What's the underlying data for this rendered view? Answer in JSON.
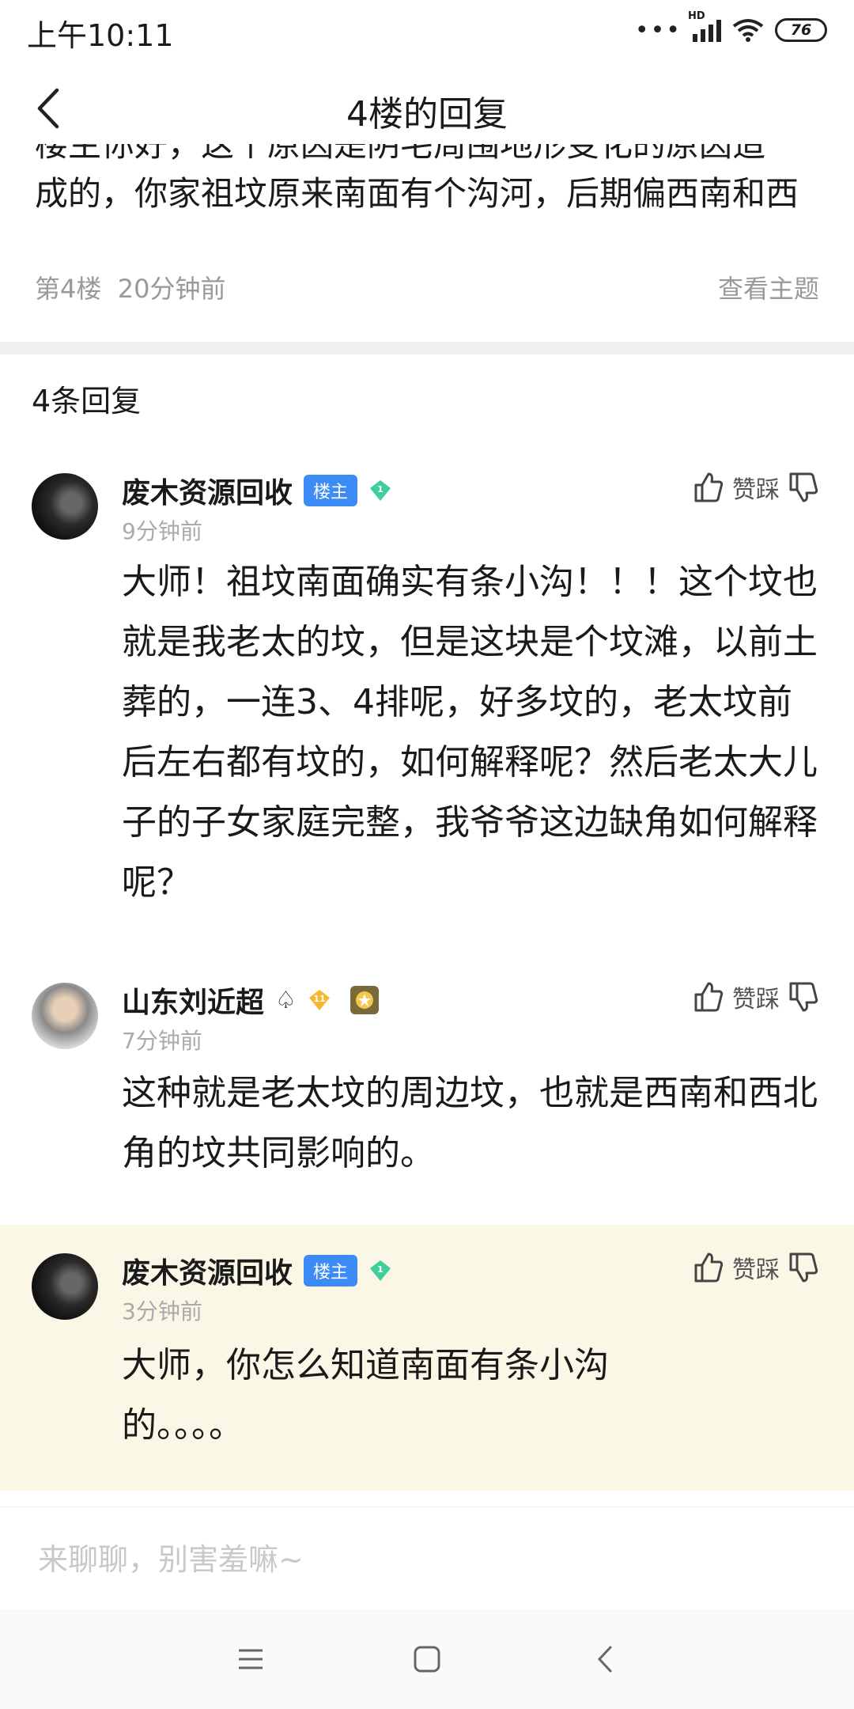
{
  "status": {
    "time": "上午10:11",
    "signal_label": "HD",
    "battery": "76"
  },
  "nav": {
    "title": "4楼的回复",
    "back_icon": "chevron-left-icon"
  },
  "post": {
    "text_line1": "楼主你好，这个原因是阴宅周围地形变化的原因造",
    "text_line2": "成的，你家祖坟原来南面有个沟河，后期偏西南和西",
    "floor": "第4楼",
    "time": "20分钟前",
    "view_topic": "查看主题"
  },
  "replies": {
    "count_label": "4条回复",
    "vote_label": "赞踩",
    "items": [
      {
        "username": "废木资源回收",
        "badge": "楼主",
        "level": "1",
        "time": "9分钟前",
        "content": "大师！祖坟南面确实有条小沟！！！这个坟也就是我老太的坟，但是这块是个坟滩，以前土葬的，一连3、4排呢，好多坟的，老太坟前后左右都有坟的，如何解释呢？然后老太大儿子的子女家庭完整，我爷爷这边缺角如何解释呢？"
      },
      {
        "username": "山东刘近超",
        "level": "11",
        "time": "7分钟前",
        "content": "这种就是老太坟的周边坟，也就是西南和西北角的坟共同影响的。"
      },
      {
        "username": "废木资源回收",
        "badge": "楼主",
        "level": "1",
        "time": "3分钟前",
        "content": "大师，你怎么知道南面有条小沟的。。。。"
      }
    ]
  },
  "input": {
    "placeholder": "来聊聊，别害羞嘛~"
  },
  "colors": {
    "op_badge": "#3d8bf5",
    "highlight_bg": "#fbf7e6",
    "gem_green": "#3fcf9a",
    "gem_gold": "#f5b82e"
  }
}
